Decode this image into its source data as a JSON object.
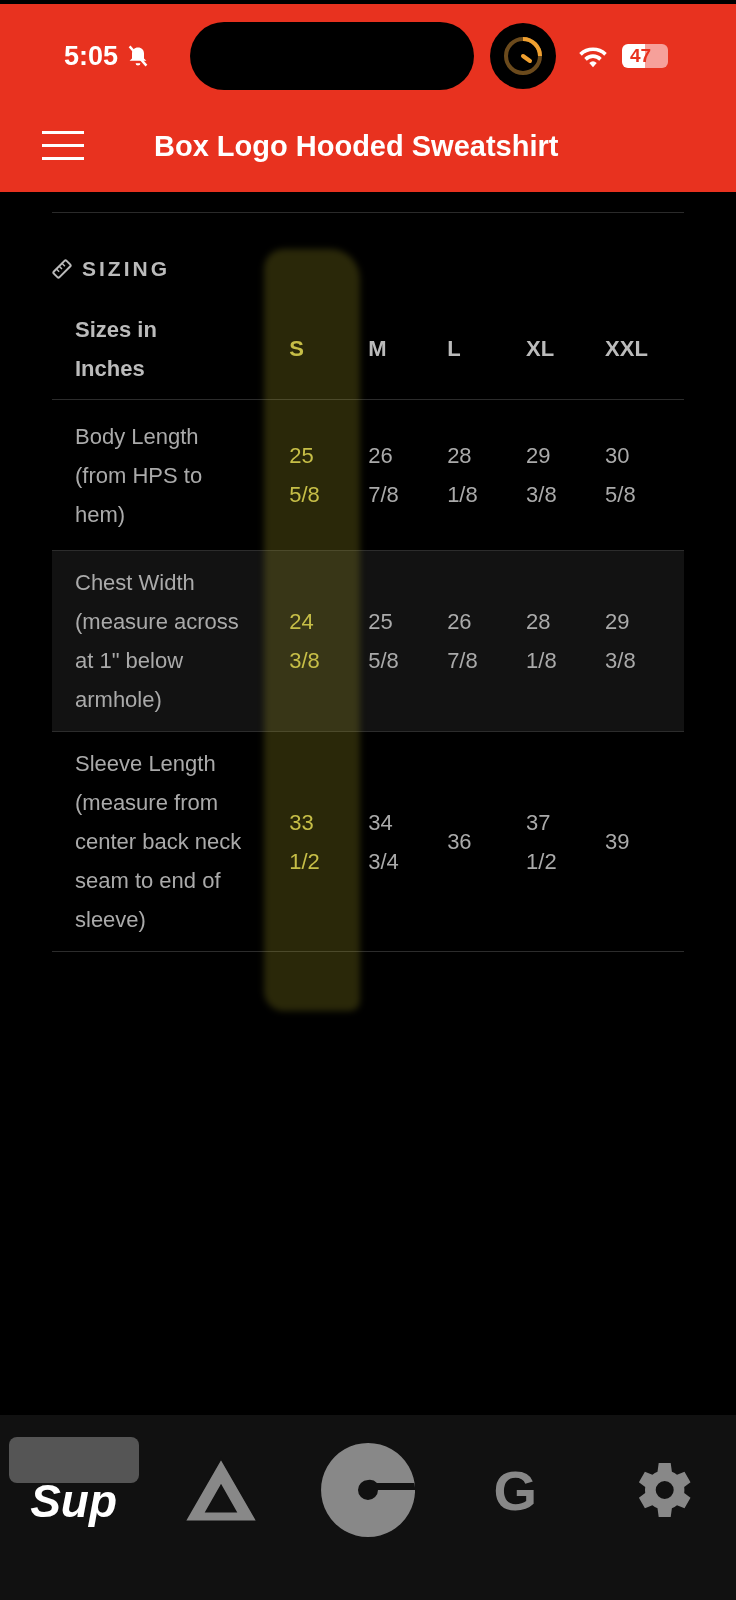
{
  "status_bar": {
    "time": "5:05",
    "battery": "47"
  },
  "header": {
    "title": "Box Logo Hooded Sweatshirt"
  },
  "section": {
    "title": "SIZING"
  },
  "table": {
    "corner": "Sizes in Inches",
    "columns": [
      {
        "label": "S",
        "highlighted": true
      },
      {
        "label": "M",
        "highlighted": false
      },
      {
        "label": "L",
        "highlighted": false
      },
      {
        "label": "XL",
        "highlighted": false
      },
      {
        "label": "XXL",
        "highlighted": false
      }
    ],
    "rows": [
      {
        "label": "Body Length (from HPS to hem)",
        "values": [
          "25 5/8",
          "26 7/8",
          "28 1/8",
          "29 3/8",
          "30 5/8"
        ]
      },
      {
        "label": "Chest Width (measure across at 1\" below armhole)",
        "values": [
          "24 3/8",
          "25 5/8",
          "26 7/8",
          "28 1/8",
          "29 3/8"
        ]
      },
      {
        "label": "Sleeve Length (measure from center back neck seam to end of sleeve)",
        "values": [
          "33 1/2",
          "34 3/4",
          "36",
          "37 1/2",
          "39"
        ]
      }
    ]
  },
  "tab_bar": [
    {
      "kind": "text",
      "label": "Sup",
      "selected": true
    },
    {
      "kind": "triangle",
      "selected": false
    },
    {
      "kind": "disc",
      "selected": false
    },
    {
      "kind": "text",
      "label": "G",
      "selected": false
    },
    {
      "kind": "gear",
      "selected": false
    }
  ]
}
